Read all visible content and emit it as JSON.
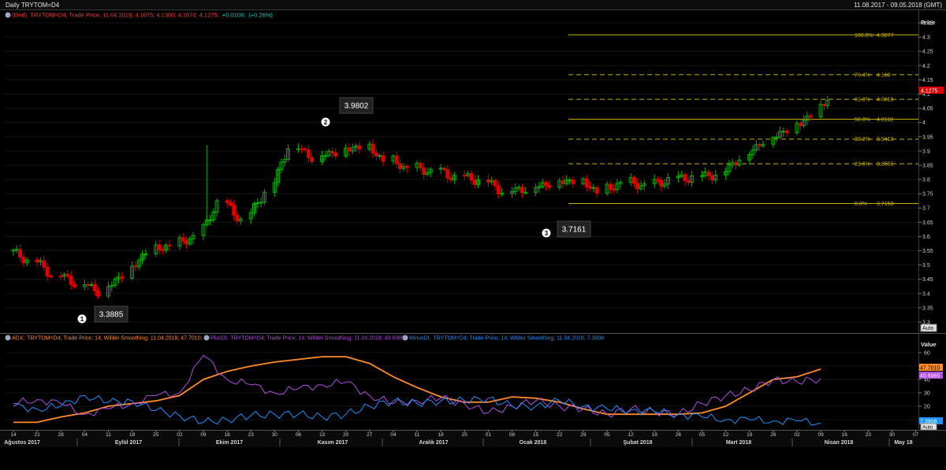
{
  "window": {
    "title": "Daily TRYTOM=D4",
    "date_range": "11.08.2017 - 09.05.2018 (GMT)"
  },
  "price_panel": {
    "legend_prefix": "(Ond)",
    "legend_desc": "TRYTOM=D4; Trade Price; 11.04.2018; 4.1075; 4.1300; 4.1074; 4.1275;",
    "legend_change": "+0.0109;",
    "legend_change_pct": "(+0.26%)",
    "axis_title": "Price",
    "last_price_label": "4.1275",
    "auto_label": "Auto",
    "colors": {
      "up": "#00b400",
      "down": "#e00000",
      "fib": "#c8b400",
      "legend_red": "#ff3b3b",
      "change": "#00d0d0"
    },
    "y_ticks": [
      "4.35",
      "4.3",
      "4.25",
      "4.2",
      "4.15",
      "4.1",
      "4.05",
      "4",
      "3.95",
      "3.9",
      "3.85",
      "3.8",
      "3.75",
      "3.7",
      "3.65",
      "3.6",
      "3.55",
      "3.5",
      "3.45",
      "3.4",
      "3.35",
      "3.3"
    ]
  },
  "fibonacci": [
    {
      "label": "100.0%",
      "value": "4.3077",
      "level": 4.3077
    },
    {
      "label": "76.4%",
      "value": "4.168",
      "level": 4.168
    },
    {
      "label": "61.8%",
      "value": "4.0816",
      "level": 4.0816
    },
    {
      "label": "50.0%",
      "value": "4.0118",
      "level": 4.0118
    },
    {
      "label": "38.2%",
      "value": "3.9419",
      "level": 3.9419
    },
    {
      "label": "23.6%",
      "value": "3.8555",
      "level": 3.8555
    },
    {
      "label": "0.0%",
      "value": "3.7158",
      "level": 3.7158
    }
  ],
  "annotations": [
    {
      "marker": "❶",
      "label": "3.3885",
      "date": "2017-09-05",
      "price": 3.3885
    },
    {
      "marker": "❷",
      "label": "3.9802",
      "date": "2017-10-30",
      "price": 3.9802
    },
    {
      "marker": "❸",
      "label": "3.7161",
      "date": "2018-01-26",
      "price": 3.7161
    }
  ],
  "adx_panel": {
    "legend_adx_name": "ADX;",
    "legend_adx": "TRYTOM=D4; Trade Price;  14; Wilder Smoothing; 11.04.2018; 47.7010;",
    "legend_plus_name": "PlusDI;",
    "legend_plus": "TRYTOM=D4; Trade Price;  14; Wilder Smoothing; 11.04.2018; 40.6965;",
    "legend_minus_name": "MinusDI;",
    "legend_minus": "TRYTOM=D4; Trade Price;  14; Wilder Smoothing; 11.04.2018; 7.3908",
    "axis_title": "Value",
    "y_ticks": [
      "60",
      "50",
      "40",
      "30",
      "20",
      "10"
    ],
    "adx_last": "47.7010",
    "plus_last": "40.6965",
    "minus_last": "7.3908",
    "auto_label": "Auto",
    "colors": {
      "adx": "#ff8c28",
      "plus": "#b04ee0",
      "minus": "#1e90ff"
    }
  },
  "x_axis": {
    "day_ticks": [
      "14",
      "21",
      "28",
      "04",
      "11",
      "18",
      "25",
      "02",
      "09",
      "16",
      "23",
      "30",
      "06",
      "13",
      "20",
      "27",
      "04",
      "11",
      "18",
      "25",
      "01",
      "08",
      "15",
      "22",
      "29",
      "05",
      "12",
      "19",
      "26",
      "05",
      "12",
      "19",
      "26",
      "02",
      "09",
      "16",
      "23",
      "30",
      "07"
    ],
    "months": [
      "Ağustos 2017",
      "Eylül 2017",
      "Ekim 2017",
      "Kasım 2017",
      "Aralık 2017",
      "Ocak 2018",
      "Şubat 2018",
      "Mart 2018",
      "Nisan 2018",
      "May 18"
    ]
  },
  "chart_data": [
    {
      "type": "candlestick",
      "title": "Daily TRYTOM=D4",
      "ylabel": "Price",
      "ylim": [
        3.28,
        4.37
      ],
      "x": [
        "2017-08-14",
        "2017-08-21",
        "2017-08-28",
        "2017-09-04",
        "2017-09-11",
        "2017-09-18",
        "2017-09-25",
        "2017-10-02",
        "2017-10-09",
        "2017-10-16",
        "2017-10-23",
        "2017-10-30",
        "2017-11-06",
        "2017-11-13",
        "2017-11-20",
        "2017-11-27",
        "2017-12-04",
        "2017-12-11",
        "2017-12-18",
        "2017-12-25",
        "2018-01-01",
        "2018-01-08",
        "2018-01-15",
        "2018-01-22",
        "2018-01-29",
        "2018-02-05",
        "2018-02-12",
        "2018-02-19",
        "2018-02-26",
        "2018-03-05",
        "2018-03-12",
        "2018-03-19",
        "2018-03-26",
        "2018-04-02",
        "2018-04-09"
      ],
      "series": [
        {
          "name": "TRYTOM=D4",
          "close": [
            3.52,
            3.47,
            3.44,
            3.41,
            3.47,
            3.55,
            3.57,
            3.6,
            3.72,
            3.66,
            3.76,
            3.92,
            3.88,
            3.9,
            3.92,
            3.87,
            3.84,
            3.83,
            3.81,
            3.8,
            3.76,
            3.77,
            3.79,
            3.8,
            3.76,
            3.79,
            3.78,
            3.8,
            3.81,
            3.82,
            3.88,
            3.94,
            3.98,
            4.03,
            4.1275
          ]
        }
      ],
      "grid": true
    },
    {
      "type": "line",
      "title": "ADX / PlusDI / MinusDI",
      "ylabel": "Value",
      "ylim": [
        0,
        65
      ],
      "x": [
        "2017-08-14",
        "2017-08-21",
        "2017-08-28",
        "2017-09-04",
        "2017-09-11",
        "2017-09-18",
        "2017-09-25",
        "2017-10-02",
        "2017-10-09",
        "2017-10-16",
        "2017-10-23",
        "2017-10-30",
        "2017-11-06",
        "2017-11-13",
        "2017-11-20",
        "2017-11-27",
        "2017-12-04",
        "2017-12-11",
        "2017-12-18",
        "2017-12-25",
        "2018-01-01",
        "2018-01-08",
        "2018-01-15",
        "2018-01-22",
        "2018-01-29",
        "2018-02-05",
        "2018-02-12",
        "2018-02-19",
        "2018-02-26",
        "2018-03-05",
        "2018-03-12",
        "2018-03-19",
        "2018-03-26",
        "2018-04-02",
        "2018-04-09"
      ],
      "series": [
        {
          "name": "ADX",
          "values": [
            8,
            8,
            12,
            15,
            20,
            22,
            24,
            28,
            40,
            46,
            50,
            53,
            55,
            57,
            57,
            52,
            42,
            34,
            27,
            23,
            23,
            27,
            26,
            23,
            18,
            14,
            14,
            14,
            14,
            15,
            20,
            30,
            40,
            42,
            47.701
          ]
        },
        {
          "name": "PlusDI",
          "values": [
            22,
            25,
            22,
            14,
            18,
            22,
            28,
            30,
            58,
            40,
            36,
            30,
            33,
            36,
            38,
            28,
            22,
            24,
            26,
            22,
            15,
            20,
            24,
            20,
            18,
            14,
            18,
            16,
            14,
            22,
            28,
            32,
            40,
            38,
            40.6965
          ]
        },
        {
          "name": "MinusDI",
          "values": [
            20,
            18,
            20,
            28,
            23,
            24,
            17,
            13,
            8,
            10,
            13,
            14,
            14,
            12,
            14,
            20,
            24,
            22,
            24,
            24,
            26,
            20,
            20,
            24,
            20,
            18,
            17,
            16,
            14,
            12,
            10,
            10,
            9,
            9,
            7.3908
          ]
        }
      ],
      "grid": true
    }
  ]
}
